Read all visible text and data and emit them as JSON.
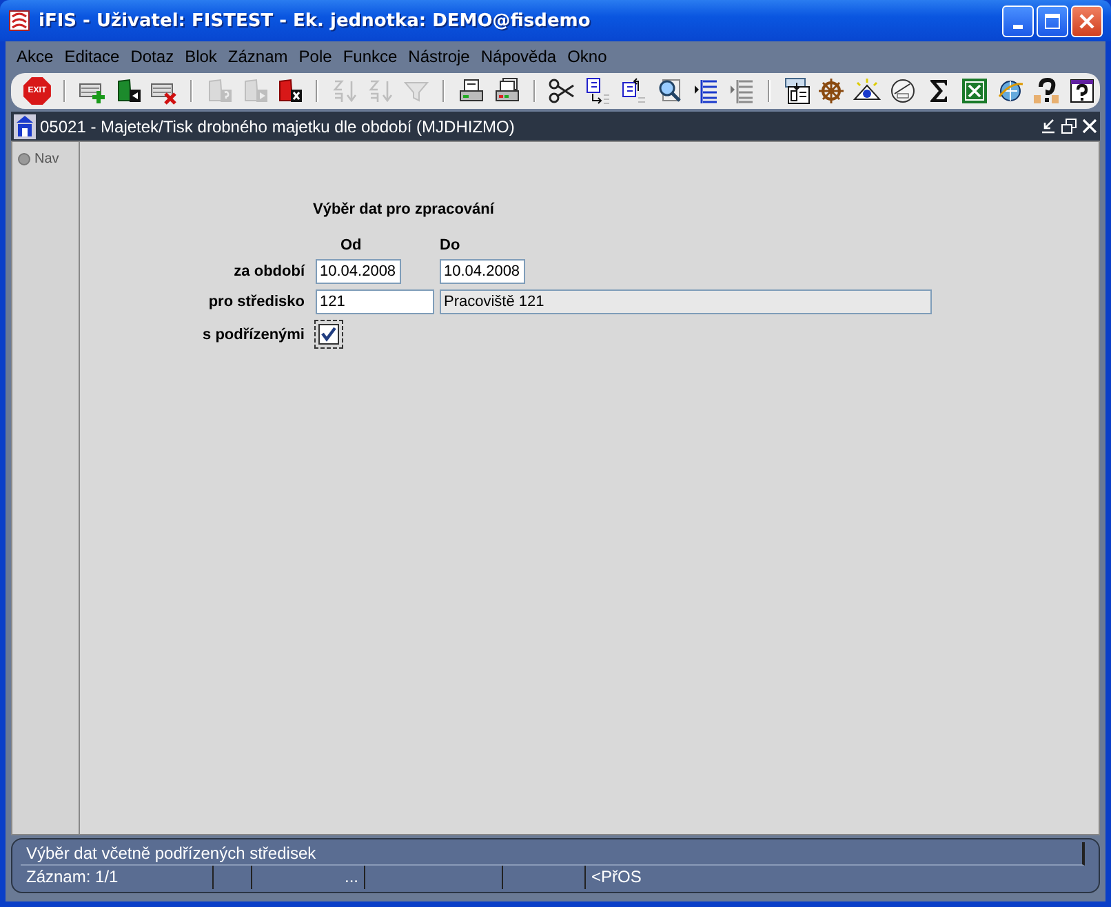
{
  "window": {
    "title": "iFIS - Uživatel: FISTEST - Ek. jednotka: DEMO@fisdemo"
  },
  "menu": [
    "Akce",
    "Editace",
    "Dotaz",
    "Blok",
    "Záznam",
    "Pole",
    "Funkce",
    "Nástroje",
    "Nápověda",
    "Okno"
  ],
  "toolbar": [
    {
      "kind": "exit",
      "label": "EXIT",
      "disabled": false
    },
    {
      "kind": "sep"
    },
    {
      "kind": "add-record",
      "disabled": false
    },
    {
      "kind": "save",
      "disabled": false
    },
    {
      "kind": "delete-record",
      "disabled": false
    },
    {
      "kind": "sep"
    },
    {
      "kind": "enter-query",
      "disabled": true
    },
    {
      "kind": "run-query",
      "disabled": true
    },
    {
      "kind": "cancel-query",
      "disabled": false
    },
    {
      "kind": "sep"
    },
    {
      "kind": "sort-asc",
      "disabled": true
    },
    {
      "kind": "sort-desc",
      "disabled": true
    },
    {
      "kind": "filter",
      "disabled": true
    },
    {
      "kind": "sep"
    },
    {
      "kind": "print",
      "disabled": false
    },
    {
      "kind": "print-setup",
      "disabled": false
    },
    {
      "kind": "sep"
    },
    {
      "kind": "cut",
      "disabled": false
    },
    {
      "kind": "copy",
      "disabled": false
    },
    {
      "kind": "paste",
      "disabled": false
    },
    {
      "kind": "zoom",
      "disabled": false
    },
    {
      "kind": "list",
      "disabled": false
    },
    {
      "kind": "list",
      "disabled": true
    },
    {
      "kind": "sep"
    },
    {
      "kind": "form",
      "disabled": false
    },
    {
      "kind": "wheel",
      "disabled": false
    },
    {
      "kind": "eye",
      "disabled": false
    },
    {
      "kind": "gauge",
      "disabled": false
    },
    {
      "kind": "sum",
      "disabled": false
    },
    {
      "kind": "excel",
      "disabled": false
    },
    {
      "kind": "browser",
      "disabled": false
    },
    {
      "kind": "help",
      "disabled": false
    },
    {
      "kind": "help-window",
      "disabled": false
    }
  ],
  "form_window": {
    "title": "05021 - Majetek/Tisk drobného majetku dle období (MJDHIZMO)",
    "nav_tab": {
      "label": "Nav",
      "selected": false
    },
    "heading": "Výběr dat pro zpracování",
    "column_headers": [
      "Od",
      "Do"
    ],
    "fields": [
      {
        "label": "za období",
        "kind": "range",
        "from": "10.04.2008",
        "to": "10.04.2008"
      },
      {
        "label": "pro středisko",
        "kind": "lookup",
        "code": "121",
        "name": "Pracoviště 121"
      },
      {
        "label": "s podřízenými",
        "kind": "checkbox",
        "checked": true
      }
    ]
  },
  "status_bar": {
    "message": "Výběr dat včetně podřízených středisek",
    "record_count": "Záznam: 1/1",
    "segment_3": "...",
    "segment_6": "<PřOS"
  }
}
